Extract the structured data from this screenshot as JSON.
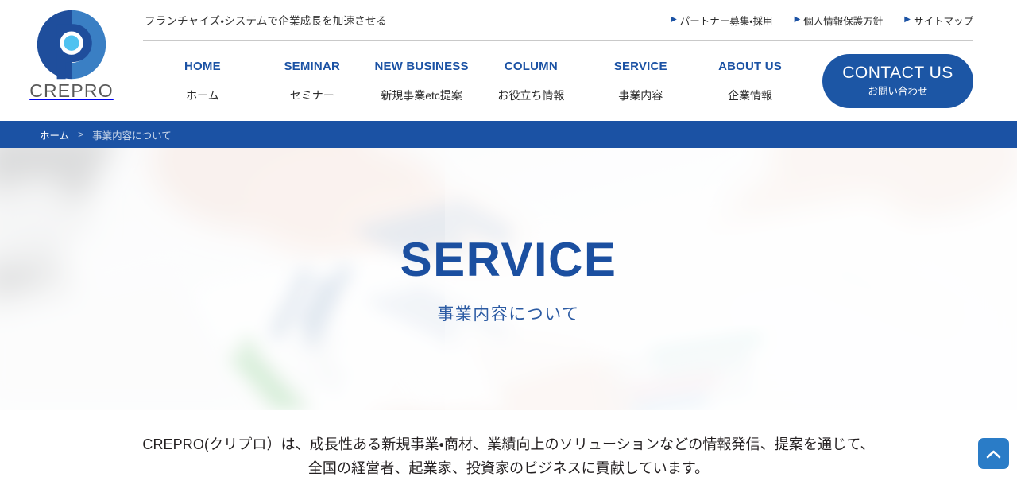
{
  "brand": {
    "logo_icon": "crepro-logo-icon",
    "wordmark": "CREPRO",
    "colors": {
      "dark_blue": "#1f4e9c",
      "mid_blue": "#3a7fc4",
      "cyan_dot": "#4fc2f0",
      "wordmark_gray": "#5a5a5a"
    }
  },
  "header": {
    "tagline": "フランチャイズ・システムで企業成長を加速させる",
    "divider": true,
    "util_links": [
      {
        "icon": "triangle-right-icon",
        "label": "パートナー募集・採用"
      },
      {
        "icon": "triangle-right-icon",
        "label": "個人情報保護方針"
      },
      {
        "icon": "triangle-right-icon",
        "label": "サイトマップ"
      }
    ],
    "nav": [
      {
        "en": "HOME",
        "ja": "ホーム"
      },
      {
        "en": "SEMINAR",
        "ja": "セミナー"
      },
      {
        "en": "NEW BUSINESS",
        "ja": "新規事業etc提案"
      },
      {
        "en": "COLUMN",
        "ja": "お役立ち情報"
      },
      {
        "en": "SERVICE",
        "ja": "事業内容"
      },
      {
        "en": "ABOUT US",
        "ja": "企業情報"
      }
    ],
    "contact": {
      "en": "CONTACT  US",
      "ja": "お問い合わせ",
      "color": "#1c56a5"
    }
  },
  "breadcrumb": {
    "home": "ホーム",
    "separator": ">",
    "current": "事業内容について",
    "bar_color": "#1b52a4"
  },
  "hero": {
    "title": "SERVICE",
    "subtitle": "事業内容について",
    "title_color": "#1b4fa0",
    "background_description": "blurred photo of hands pointing at printed business charts and documents on a white desk"
  },
  "lead": {
    "line1": "CREPRO(クリプロ）は、成長性ある新規事業・商材、業績向上のソリューションなどの情報発信、提案を通じて、",
    "line2": "全国の経営者、起業家、投資家のビジネスに貢献しています。"
  },
  "to_top": {
    "icon": "chevron-up-icon",
    "color": "#2a7cc7"
  }
}
